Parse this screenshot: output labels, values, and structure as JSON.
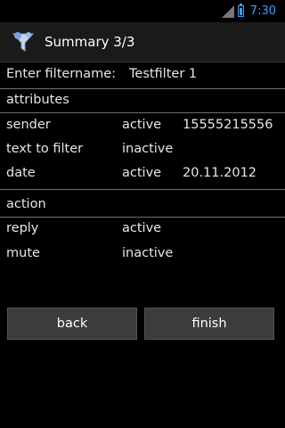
{
  "status": {
    "time": "7:30"
  },
  "title": "Summary 3/3",
  "filtername": {
    "label": "Enter filtername:",
    "value": "Testfilter 1"
  },
  "attributes": {
    "header": "attributes",
    "rows": [
      {
        "name": "sender",
        "status": "active",
        "value": "15555215556"
      },
      {
        "name": "text to filter",
        "status": "inactive",
        "value": ""
      },
      {
        "name": "date",
        "status": "active",
        "value": "20.11.2012"
      }
    ]
  },
  "action": {
    "header": "action",
    "rows": [
      {
        "name": "reply",
        "status": "active"
      },
      {
        "name": "mute",
        "status": "inactive"
      }
    ]
  },
  "buttons": {
    "back": "back",
    "finish": "finish"
  },
  "colors": {
    "accent": "#3aa0ff",
    "background": "#000000",
    "button": "#3c3c3c"
  },
  "icons": {
    "app": "filter-funnel-icon",
    "signal": "signal-icon",
    "battery": "battery-icon"
  }
}
